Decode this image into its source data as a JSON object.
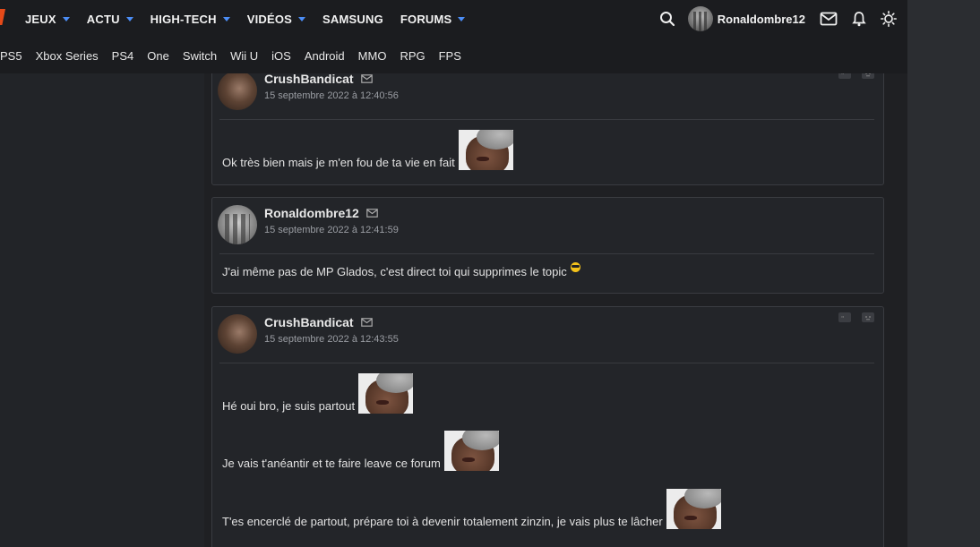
{
  "nav": {
    "items": [
      {
        "label": "JEUX",
        "has_dropdown": true
      },
      {
        "label": "ACTU",
        "has_dropdown": true
      },
      {
        "label": "HIGH-TECH",
        "has_dropdown": true
      },
      {
        "label": "VIDÉOS",
        "has_dropdown": true
      },
      {
        "label": "SAMSUNG",
        "has_dropdown": false
      },
      {
        "label": "FORUMS",
        "has_dropdown": true
      }
    ],
    "user": {
      "name": "Ronaldombre12"
    },
    "icons": [
      "search-icon",
      "mail-icon",
      "bell-icon",
      "sun-icon"
    ],
    "accent_color": "#4c8ef7"
  },
  "platforms": [
    "PS5",
    "Xbox Series",
    "PS4",
    "One",
    "Switch",
    "Wii U",
    "iOS",
    "Android",
    "MMO",
    "RPG",
    "FPS"
  ],
  "posts": [
    {
      "author": "CrushBandicat",
      "date": "15 septembre 2022 à 12:40:56",
      "lines": [
        {
          "text": "Ok très bien mais je m'en fou de ta vie en fait",
          "sticker": true
        }
      ]
    },
    {
      "author": "Ronaldombre12",
      "date": "15 septembre 2022 à 12:41:59",
      "lines": [
        {
          "text": "J'ai même pas de MP Glados, c'est direct toi qui supprimes le topic",
          "emoji": true
        }
      ]
    },
    {
      "author": "CrushBandicat",
      "date": "15 septembre 2022 à 12:43:55",
      "lines": [
        {
          "text": "Hé oui bro, je suis partout",
          "sticker": true
        },
        {
          "text": "Je vais t'anéantir et te faire leave ce forum",
          "sticker": true
        },
        {
          "text": "T'es encerclé de partout, prépare toi à devenir totalement zinzin, je vais plus te lâcher",
          "sticker": true
        }
      ]
    }
  ]
}
